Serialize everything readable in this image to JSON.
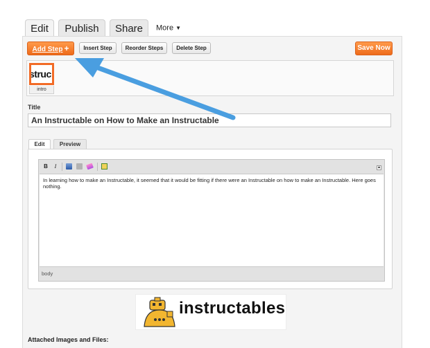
{
  "tabs": [
    {
      "label": "Edit",
      "active": true
    },
    {
      "label": "Publish",
      "active": false
    },
    {
      "label": "Share",
      "active": false
    }
  ],
  "more_label": "More",
  "toolbar": {
    "add_step": "Add Step",
    "insert_step": "Insert Step",
    "reorder_steps": "Reorder Steps",
    "delete_step": "Delete Step",
    "save_now": "Save Now"
  },
  "steps": [
    {
      "thumb_text": "struc",
      "label": "intro"
    }
  ],
  "title_section": {
    "label": "Title",
    "value": "An Instructable on How to Make an Instructable"
  },
  "editor": {
    "tabs": [
      "Edit",
      "Preview"
    ],
    "format_buttons": [
      "B",
      "I"
    ],
    "body_text": "In learning how to make an Instructable, it seemed that it would be fitting if there were an Instructable on how to make an Instructable. Here goes nothing.",
    "status": "body"
  },
  "logo_text": "instructables",
  "attached": {
    "heading": "Attached Images and Files:"
  },
  "colors": {
    "accent_orange": "#f26b26",
    "annotation_arrow": "#5aaee6"
  }
}
